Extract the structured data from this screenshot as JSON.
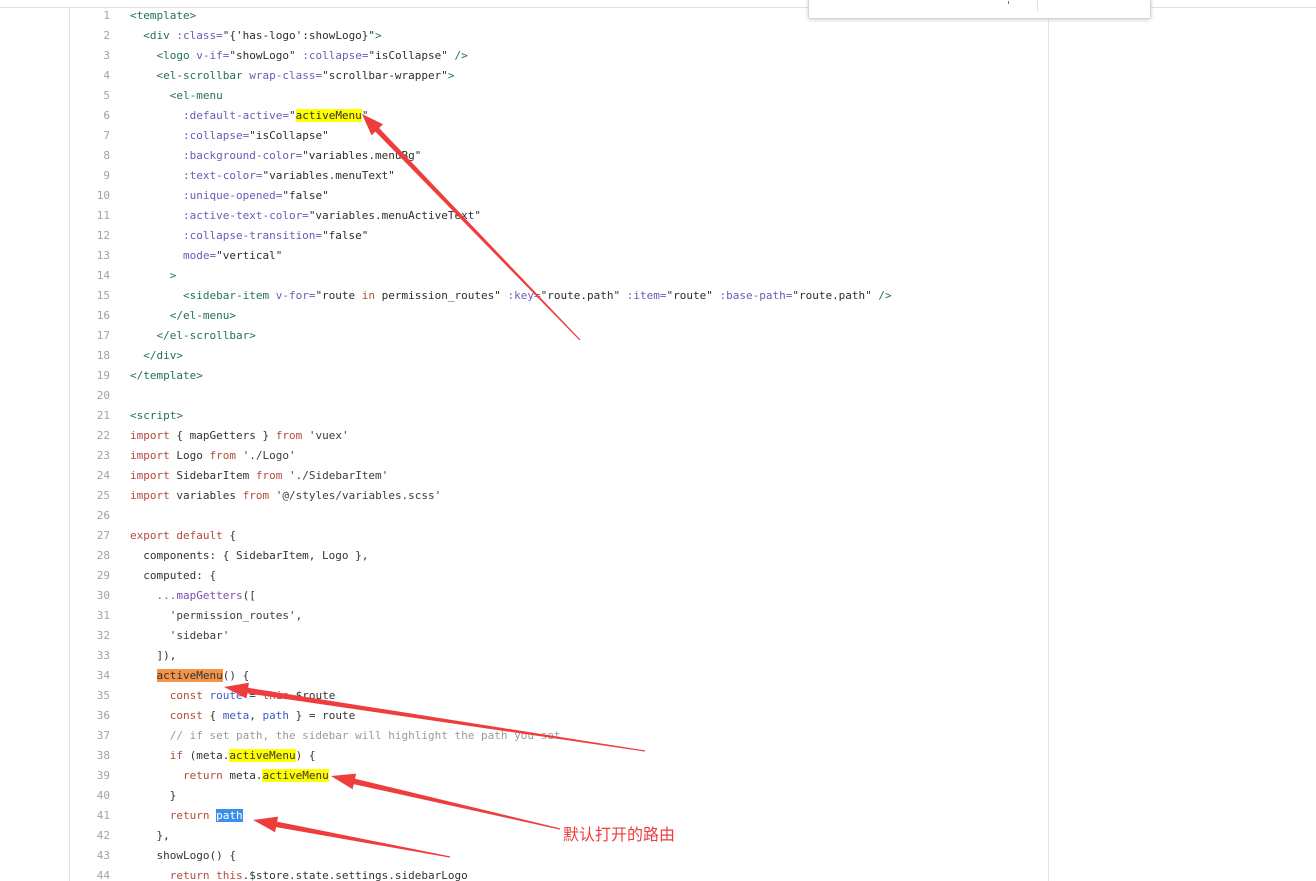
{
  "editor": {
    "lines": [
      {
        "n": 1,
        "s": [
          [
            "<template>",
            1
          ]
        ]
      },
      {
        "n": 2,
        "s": [
          [
            "  <div",
            1
          ],
          [
            " :class=",
            2
          ],
          [
            "\"{'has-logo':showLogo}\"",
            3
          ],
          [
            ">",
            1
          ]
        ]
      },
      {
        "n": 3,
        "s": [
          [
            "    <logo",
            1
          ],
          [
            " v-if=",
            2
          ],
          [
            "\"showLogo\"",
            3
          ],
          [
            " :collapse=",
            2
          ],
          [
            "\"isCollapse\"",
            3
          ],
          [
            " />",
            1
          ]
        ]
      },
      {
        "n": 4,
        "s": [
          [
            "    <el-scrollbar",
            1
          ],
          [
            " wrap-class=",
            2
          ],
          [
            "\"scrollbar-wrapper\"",
            3
          ],
          [
            ">",
            1
          ]
        ]
      },
      {
        "n": 5,
        "s": [
          [
            "      <el-menu",
            1
          ]
        ]
      },
      {
        "n": 6,
        "s": [
          [
            "        :default-active=",
            2
          ],
          [
            "\"",
            3
          ],
          [
            "activeMenu",
            3,
            0
          ],
          [
            "\"",
            3
          ]
        ]
      },
      {
        "n": 7,
        "s": [
          [
            "        :collapse=",
            2
          ],
          [
            "\"isCollapse\"",
            3
          ]
        ]
      },
      {
        "n": 8,
        "s": [
          [
            "        :background-color=",
            2
          ],
          [
            "\"variables.menuBg\"",
            3
          ]
        ]
      },
      {
        "n": 9,
        "s": [
          [
            "        :text-color=",
            2
          ],
          [
            "\"variables.menuText\"",
            3
          ]
        ]
      },
      {
        "n": 10,
        "s": [
          [
            "        :unique-opened=",
            2
          ],
          [
            "\"false\"",
            3
          ]
        ]
      },
      {
        "n": 11,
        "s": [
          [
            "        :active-text-color=",
            2
          ],
          [
            "\"variables.menuActiveText\"",
            3
          ]
        ]
      },
      {
        "n": 12,
        "s": [
          [
            "        :collapse-transition=",
            2
          ],
          [
            "\"false\"",
            3
          ]
        ]
      },
      {
        "n": 13,
        "s": [
          [
            "        mode=",
            2
          ],
          [
            "\"vertical\"",
            3
          ]
        ]
      },
      {
        "n": 14,
        "s": [
          [
            "      >",
            1
          ]
        ]
      },
      {
        "n": 15,
        "s": [
          [
            "        <sidebar-item",
            1
          ],
          [
            " v-for=",
            2
          ],
          [
            "\"route ",
            3
          ],
          [
            "in",
            4
          ],
          [
            " permission_routes\"",
            3
          ],
          [
            " :key=",
            2
          ],
          [
            "\"route.path\"",
            3
          ],
          [
            " :item=",
            2
          ],
          [
            "\"route\"",
            3
          ],
          [
            " :base-path=",
            2
          ],
          [
            "\"route.path\"",
            3
          ],
          [
            " />",
            1
          ]
        ]
      },
      {
        "n": 16,
        "s": [
          [
            "      </el-menu>",
            1
          ]
        ]
      },
      {
        "n": 17,
        "s": [
          [
            "    </el-scrollbar>",
            1
          ]
        ]
      },
      {
        "n": 18,
        "s": [
          [
            "  </div>",
            1
          ]
        ]
      },
      {
        "n": 19,
        "s": [
          [
            "</template>",
            1
          ]
        ]
      },
      {
        "n": 20,
        "s": []
      },
      {
        "n": 21,
        "s": [
          [
            "<script>",
            1
          ]
        ]
      },
      {
        "n": 22,
        "s": [
          [
            "import",
            4
          ],
          [
            " { mapGetters } ",
            0
          ],
          [
            "from",
            4
          ],
          [
            " 'vuex'",
            5
          ]
        ]
      },
      {
        "n": 23,
        "s": [
          [
            "import",
            4
          ],
          [
            " Logo ",
            0
          ],
          [
            "from",
            4
          ],
          [
            " './Logo'",
            5
          ]
        ]
      },
      {
        "n": 24,
        "s": [
          [
            "import",
            4
          ],
          [
            " SidebarItem ",
            0
          ],
          [
            "from",
            4
          ],
          [
            " './SidebarItem'",
            5
          ]
        ]
      },
      {
        "n": 25,
        "s": [
          [
            "import",
            4
          ],
          [
            " variables ",
            0
          ],
          [
            "from",
            4
          ],
          [
            " '@/styles/variables.scss'",
            5
          ]
        ]
      },
      {
        "n": 26,
        "s": []
      },
      {
        "n": 27,
        "s": [
          [
            "export default",
            4
          ],
          [
            " {",
            0
          ]
        ]
      },
      {
        "n": 28,
        "s": [
          [
            "  components: { SidebarItem, Logo },",
            0
          ]
        ]
      },
      {
        "n": 29,
        "s": [
          [
            "  computed: {",
            0
          ]
        ]
      },
      {
        "n": 30,
        "s": [
          [
            "    ...mapGetters",
            9
          ],
          [
            "([",
            0
          ]
        ]
      },
      {
        "n": 31,
        "s": [
          [
            "      'permission_routes'",
            5
          ],
          [
            ",",
            0
          ]
        ]
      },
      {
        "n": 32,
        "s": [
          [
            "      'sidebar'",
            5
          ]
        ]
      },
      {
        "n": 33,
        "s": [
          [
            "    ]),",
            0
          ]
        ]
      },
      {
        "n": 34,
        "s": [
          [
            "    ",
            0
          ],
          [
            "activeMenu",
            0,
            1
          ],
          [
            "() {",
            0
          ]
        ]
      },
      {
        "n": 35,
        "s": [
          [
            "      const",
            4
          ],
          [
            " route",
            7
          ],
          [
            " = ",
            0
          ],
          [
            "this",
            4
          ],
          [
            ".$route",
            0
          ]
        ]
      },
      {
        "n": 36,
        "s": [
          [
            "      const",
            4
          ],
          [
            " { ",
            0
          ],
          [
            "meta",
            7
          ],
          [
            ", ",
            0
          ],
          [
            "path",
            7
          ],
          [
            " } = route",
            0
          ]
        ]
      },
      {
        "n": 37,
        "s": [
          [
            "      // if set path, the sidebar will highlight the path you set",
            6
          ]
        ]
      },
      {
        "n": 38,
        "s": [
          [
            "      if",
            4
          ],
          [
            " (meta.",
            0
          ],
          [
            "activeMenu",
            0,
            0
          ],
          [
            ") {",
            0
          ]
        ]
      },
      {
        "n": 39,
        "s": [
          [
            "        return",
            4
          ],
          [
            " meta.",
            0
          ],
          [
            "activeMenu",
            0,
            0
          ]
        ]
      },
      {
        "n": 40,
        "s": [
          [
            "      }",
            0
          ]
        ]
      },
      {
        "n": 41,
        "s": [
          [
            "      return ",
            4
          ],
          [
            "path",
            8,
            2
          ]
        ]
      },
      {
        "n": 42,
        "s": [
          [
            "    },",
            0
          ]
        ]
      },
      {
        "n": 43,
        "s": [
          [
            "    showLogo() {",
            0
          ]
        ]
      },
      {
        "n": 44,
        "s": [
          [
            "      return this",
            4
          ],
          [
            ".$store.state.settings.sidebarLogo",
            0
          ]
        ]
      }
    ]
  },
  "palette": {
    "fg": [
      "#333333",
      "#22725a",
      "#6c5ab8",
      "#2d2d2d",
      "#b54a3c",
      "#3d3d3d",
      "#9a9a9a",
      "#3d5cc4",
      "#ffffff",
      "#7a4fb0"
    ],
    "bg": [
      "#ffff00",
      "#f39448",
      "#3b8eea"
    ]
  },
  "ui": {
    "background": "#ffffff",
    "rule": "#e3e3e3",
    "gutter_text": "#a3a3a3",
    "popup_border": "#d4d4d4"
  },
  "annotation": {
    "note": "默认打开的路由",
    "color": "#ee3d3d"
  }
}
